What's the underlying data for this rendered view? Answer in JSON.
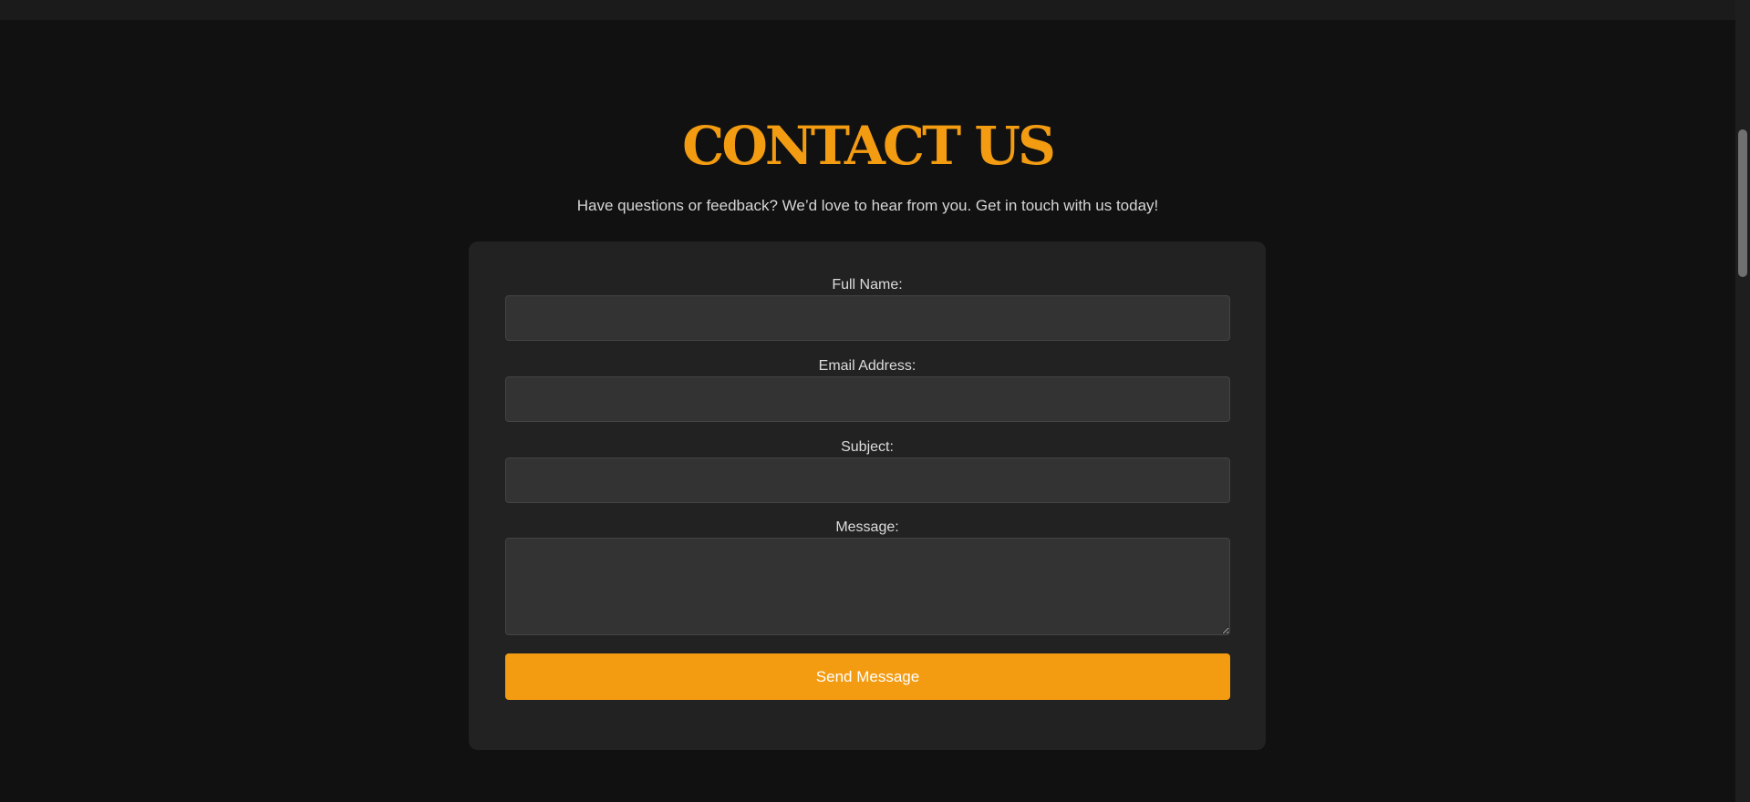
{
  "header": {
    "title": "CONTACT US",
    "subtitle": "Have questions or feedback? We’d love to hear from you. Get in touch with us today!"
  },
  "form": {
    "full_name": {
      "label": "Full Name:",
      "value": "",
      "placeholder": ""
    },
    "email": {
      "label": "Email Address:",
      "value": "",
      "placeholder": ""
    },
    "subject": {
      "label": "Subject:",
      "value": "",
      "placeholder": ""
    },
    "message": {
      "label": "Message:",
      "value": "",
      "placeholder": ""
    },
    "submit_label": "Send Message"
  },
  "colors": {
    "accent": "#f39c12",
    "background": "#111111",
    "card": "#222222",
    "input": "#333333"
  },
  "scrollbar": {
    "position_fraction": 0.18
  }
}
